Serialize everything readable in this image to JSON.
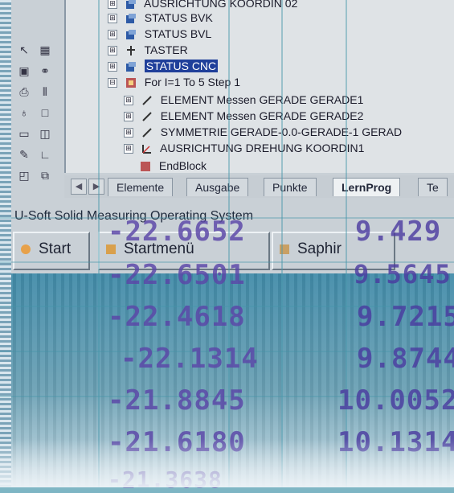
{
  "tree": {
    "items": [
      {
        "label": "AUSRICHTUNG KOORDIN 02",
        "indent": 0,
        "expander": "⊞",
        "highlighted": false
      },
      {
        "label": "STATUS BVK",
        "indent": 0,
        "expander": "⊞",
        "highlighted": false
      },
      {
        "label": "STATUS BVL",
        "indent": 0,
        "expander": "⊞",
        "highlighted": false
      },
      {
        "label": "TASTER",
        "indent": 0,
        "expander": "⊞",
        "highlighted": false
      },
      {
        "label": "STATUS CNC",
        "indent": 0,
        "expander": "⊞",
        "highlighted": true
      },
      {
        "label": "For I=1 To 5 Step 1",
        "indent": 0,
        "expander": "⊟",
        "highlighted": false
      },
      {
        "label": "ELEMENT Messen GERADE GERADE1",
        "indent": 1,
        "expander": "⊞",
        "highlighted": false
      },
      {
        "label": "ELEMENT Messen GERADE GERADE2",
        "indent": 1,
        "expander": "⊞",
        "highlighted": false
      },
      {
        "label": "SYMMETRIE GERADE-0.0-GERADE-1 GERAD",
        "indent": 1,
        "expander": "⊞",
        "highlighted": false
      },
      {
        "label": "AUSRICHTUNG DREHUNG KOORDIN1",
        "indent": 1,
        "expander": "⊞",
        "highlighted": false
      },
      {
        "label": "EndBlock",
        "indent": 1,
        "expander": "",
        "highlighted": false
      }
    ]
  },
  "tabs": [
    {
      "label": "Elemente",
      "active": false
    },
    {
      "label": "Ausgabe",
      "active": false
    },
    {
      "label": "Punkte",
      "active": false
    },
    {
      "label": "LernProg",
      "active": true
    },
    {
      "label": "Te",
      "active": false
    }
  ],
  "os_title": "U-Soft Solid Measuring Operating System",
  "taskbar": {
    "start_label": "Start",
    "startmenu_label": "Startmenü",
    "saphir_label": "Saphir"
  },
  "overlay_numbers": {
    "left": [
      "-22.6652",
      "-22.6501",
      "-22.4618",
      "-22.1314",
      "-21.8845",
      "-21.6180",
      "-21.3638"
    ],
    "right": [
      "9.429",
      "9.5645",
      "9.7215",
      "9.8744",
      "10.0052",
      "10.1314"
    ]
  },
  "colors": {
    "highlight": "#1f3f9a",
    "overlay_text": "#5b46a8",
    "background": "#5f9fb7"
  }
}
